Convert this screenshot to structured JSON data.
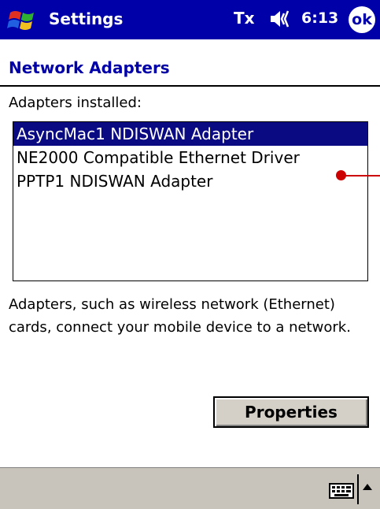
{
  "titlebar": {
    "title": "Settings",
    "connection_icon": "Tx",
    "time": "6:13",
    "ok_label": "ok"
  },
  "page": {
    "title": "Network Adapters"
  },
  "adapters": {
    "label": "Adapters installed:",
    "items": [
      "AsyncMac1 NDISWAN Adapter",
      "NE2000 Compatible Ethernet Driver",
      "PPTP1 NDISWAN Adapter"
    ],
    "selected_index": 0
  },
  "description": "Adapters, such as wireless network (Ethernet) cards, connect your mobile device to a network.",
  "buttons": {
    "properties_label": "Properties"
  },
  "icons": {
    "start": "windows-flag-icon",
    "volume": "speaker-icon",
    "keyboard": "keyboard-icon",
    "sip": "up-arrow-icon"
  },
  "colors": {
    "titlebar": "#0000a8",
    "selection": "#0a0a82",
    "callout": "#cc0000"
  }
}
